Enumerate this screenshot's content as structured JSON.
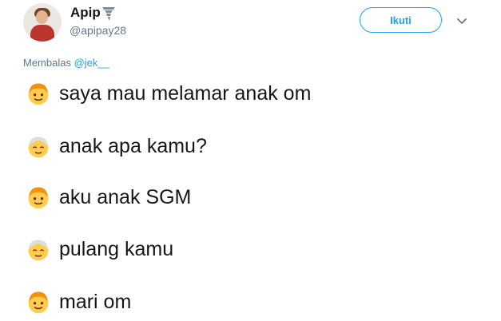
{
  "user": {
    "display_name": "Apip",
    "handle": "@apipay28"
  },
  "actions": {
    "follow_label": "Ikuti"
  },
  "reply": {
    "prefix": "Membalas",
    "mention": "@jek__"
  },
  "tweet": {
    "lines": [
      {
        "icon": "boy-face-emoji",
        "text": "saya mau melamar anak om"
      },
      {
        "icon": "old-man-face-emoji",
        "text": "anak apa kamu?"
      },
      {
        "icon": "boy-face-emoji",
        "text": "aku anak SGM"
      },
      {
        "icon": "old-man-face-emoji",
        "text": "pulang kamu"
      },
      {
        "icon": "boy-face-emoji",
        "text": "mari om"
      }
    ]
  },
  "colors": {
    "accent": "#1da1f2",
    "secondary_text": "#657786",
    "primary_text": "#14171a"
  }
}
